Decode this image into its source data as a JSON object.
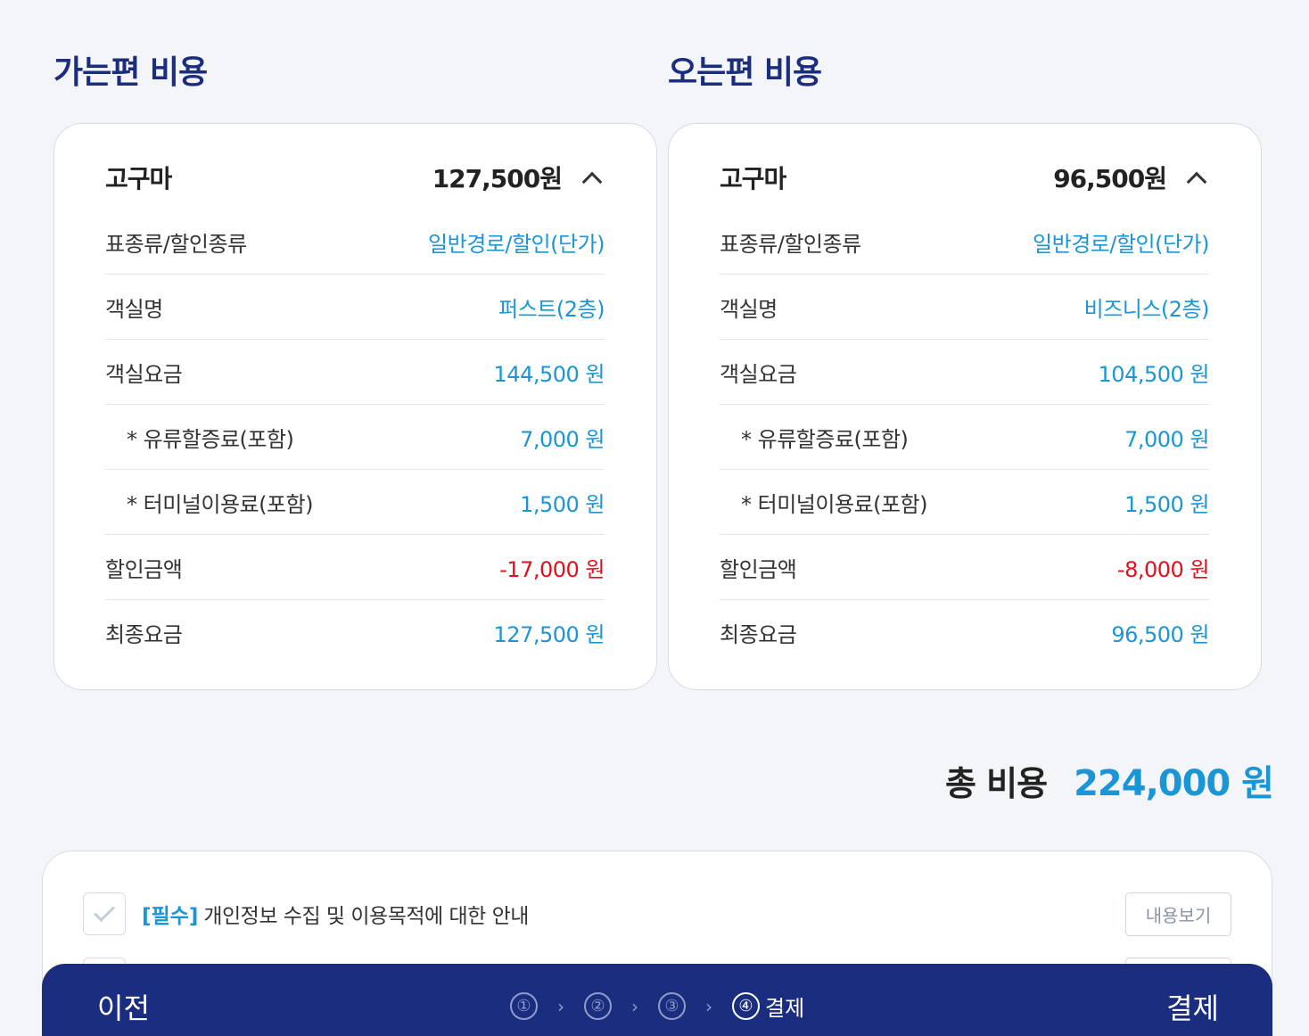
{
  "outbound": {
    "title": "가는편 비용",
    "ship_name": "고구마",
    "total": "127,500원",
    "rows": [
      {
        "label": "표종류/할인종류",
        "value": "일반경로/할인(단가)"
      },
      {
        "label": "객실명",
        "value": "퍼스트(2층)"
      },
      {
        "label": "객실요금",
        "value": "144,500 원"
      },
      {
        "label": "* 유류할증료(포함)",
        "value": "7,000 원"
      },
      {
        "label": "* 터미널이용료(포함)",
        "value": "1,500 원"
      },
      {
        "label": "할인금액",
        "value": "-17,000 원"
      },
      {
        "label": "최종요금",
        "value": "127,500 원"
      }
    ]
  },
  "return": {
    "title": "오는편 비용",
    "ship_name": "고구마",
    "total": "96,500원",
    "rows": [
      {
        "label": "표종류/할인종류",
        "value": "일반경로/할인(단가)"
      },
      {
        "label": "객실명",
        "value": "비즈니스(2층)"
      },
      {
        "label": "객실요금",
        "value": "104,500 원"
      },
      {
        "label": "* 유류할증료(포함)",
        "value": "7,000 원"
      },
      {
        "label": "* 터미널이용료(포함)",
        "value": "1,500 원"
      },
      {
        "label": "할인금액",
        "value": "-8,000 원"
      },
      {
        "label": "최종요금",
        "value": "96,500 원"
      }
    ]
  },
  "summary": {
    "total_label": "총 비용",
    "total_value": "224,000 원"
  },
  "agreements": [
    {
      "required_tag": "[필수]",
      "text": "개인정보 수집 및 이용목적에 대한 안내",
      "button": "내용보기"
    }
  ],
  "footer": {
    "prev_label": "이전",
    "steps": [
      "①",
      "②",
      "③",
      "④"
    ],
    "separator": "›",
    "current_step_label": "결제",
    "next_label": "결제"
  },
  "colors": {
    "brand_navy": "#1b2d7f",
    "accent_blue": "#1a96d6",
    "negative_red": "#e3101b"
  }
}
